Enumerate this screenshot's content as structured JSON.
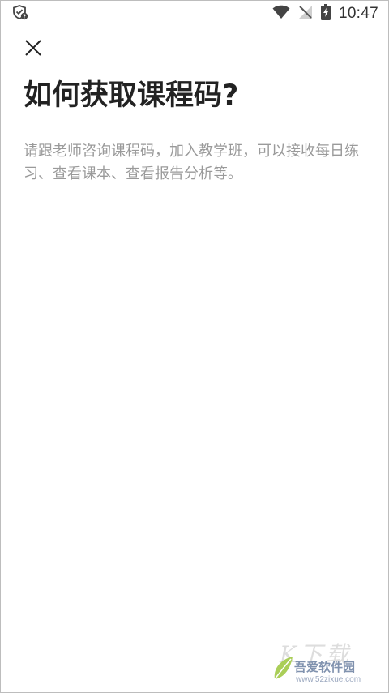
{
  "status_bar": {
    "time": "10:47",
    "icons": [
      "shield-notification-icon",
      "wifi-icon",
      "no-signal-icon",
      "battery-charging-icon"
    ]
  },
  "dialog": {
    "close_icon": "close-icon",
    "title": "如何获取课程码?",
    "description": "请跟老师咨询课程码，加入教学班，可以接收每日练习、查看课本、查看报告分析等。"
  },
  "watermark": {
    "name": "吾爱软件园",
    "url": "www.52zixue.com",
    "ghost_text": "K下载"
  },
  "colors": {
    "title": "#222222",
    "description": "#9a9a9a",
    "background": "#ffffff"
  }
}
